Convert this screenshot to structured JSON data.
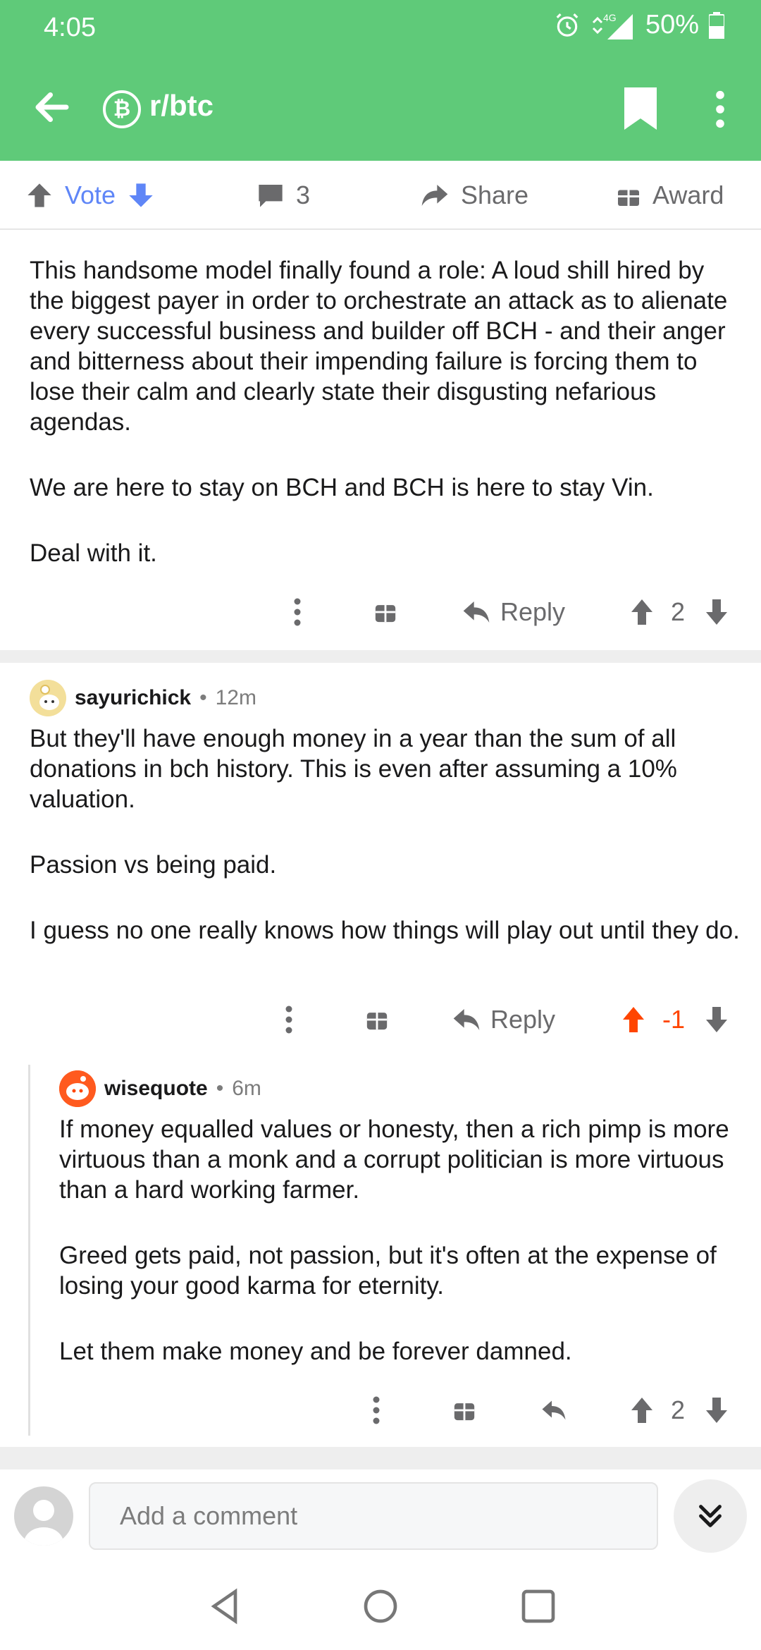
{
  "status_bar": {
    "time": "4:05",
    "network": "4G",
    "battery": "50%"
  },
  "header": {
    "subreddit": "r/btc",
    "subreddit_icon": "bitcoin-icon",
    "color": "#5fca79"
  },
  "post_actions": {
    "vote_label": "Vote",
    "comment_count": "3",
    "share_label": "Share",
    "award_label": "Award",
    "vote_color": "#5f86f7"
  },
  "comments": [
    {
      "paragraphs": [
        "This handsome model finally found a role: A loud shill hired by the biggest payer in order to orchestrate an attack as to alienate every successful business and builder off BCH - and their anger and bitterness about their impending failure is forcing them to lose their calm and clearly state their disgusting nefarious agendas.",
        "We are here to stay on BCH and BCH is here to stay Vin.",
        "Deal with it."
      ],
      "reply_label": "Reply",
      "score": "2"
    },
    {
      "author": "sayurichick",
      "age": "12m",
      "paragraphs": [
        "But they'll have enough money in a year than the sum of all donations in bch history. This is even after assuming a 10% valuation.",
        "Passion vs being paid.",
        "I guess no one really knows how things will play out until they do."
      ],
      "reply_label": "Reply",
      "score": "-1",
      "score_color": "#ff4500"
    },
    {
      "author": "wisequote",
      "age": "6m",
      "paragraphs": [
        "If money equalled values or honesty,  then a rich pimp is more virtuous than a monk and a corrupt politician is more virtuous than a hard working farmer.",
        "Greed gets paid, not passion,  but it's often at the expense of losing your good karma for eternity.",
        "Let them make money and be forever damned."
      ],
      "score": "2"
    }
  ],
  "comment_bar": {
    "placeholder": "Add a comment"
  }
}
